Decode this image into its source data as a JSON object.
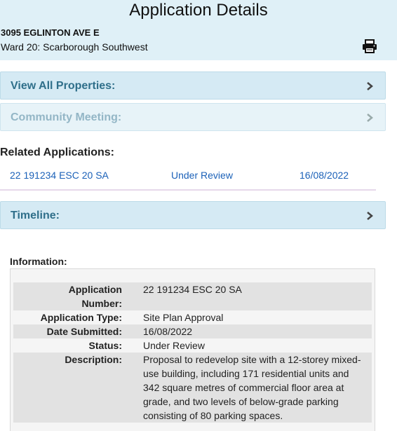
{
  "header": {
    "title": "Application Details",
    "address": "3095 EGLINTON AVE E",
    "ward": "Ward 20: Scarborough Southwest",
    "print_icon": "printer-icon"
  },
  "accordions": {
    "view_all_properties": "View All Properties:",
    "community_meeting": "Community Meeting:",
    "timeline": "Timeline:"
  },
  "related": {
    "heading": "Related Applications:",
    "rows": [
      {
        "number": "22 191234 ESC 20 SA",
        "status": "Under Review",
        "date": "16/08/2022"
      }
    ]
  },
  "information": {
    "heading": "Information:",
    "application_number_label": "Application Number:",
    "application_number": "22 191234 ESC 20 SA",
    "application_type_label": "Application Type:",
    "application_type": "Site Plan Approval",
    "date_submitted_label": "Date Submitted:",
    "date_submitted": "16/08/2022",
    "status_label": "Status:",
    "status": "Under Review",
    "description_label": "Description:",
    "description": "Proposal to redevelop site with a 12-storey mixed-use building, including 171 residential units and 342 square metres of commercial floor area at grade, and two levels of below-grade parking consisting of 80 parking spaces."
  },
  "colors": {
    "header_bg": "#dff0f7",
    "accordion_bg": "#d5eaf4",
    "accordion_text": "#2f6f8a",
    "link": "#1b61b8"
  }
}
